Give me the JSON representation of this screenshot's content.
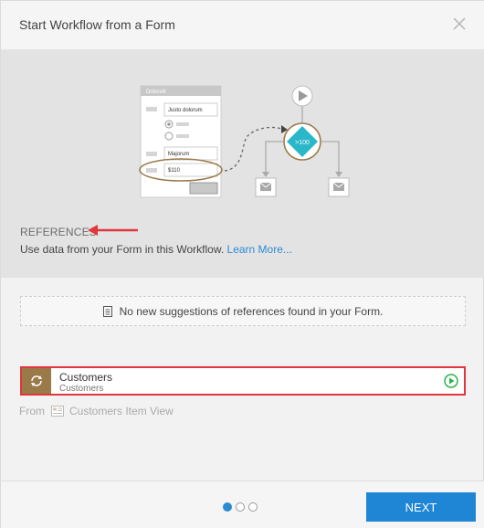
{
  "dialog": {
    "title": "Start Workflow from a Form"
  },
  "hero": {
    "illustration_form": {
      "header": "Dolorsiti",
      "field1": "Justo dolorum",
      "field2": "Majorum",
      "field3": "$110"
    },
    "illustration_condition": ">100",
    "reference_label": "REFERENCES",
    "description": "Use data from your Form in this Workflow.",
    "learn_more": "Learn More..."
  },
  "suggestions": {
    "message": "No new suggestions of references found in your Form."
  },
  "reference": {
    "name": "Customers",
    "subtitle": "Customers",
    "from_label": "From",
    "from_source": "Customers Item View"
  },
  "footer": {
    "pager": {
      "total": 3,
      "active": 1
    },
    "next_label": "NEXT"
  },
  "colors": {
    "accent": "#1f86d6",
    "highlight_border": "#e0363c",
    "badge": "#9b7a4a",
    "play": "#2bb24c",
    "condition": "#2ab7c9"
  }
}
